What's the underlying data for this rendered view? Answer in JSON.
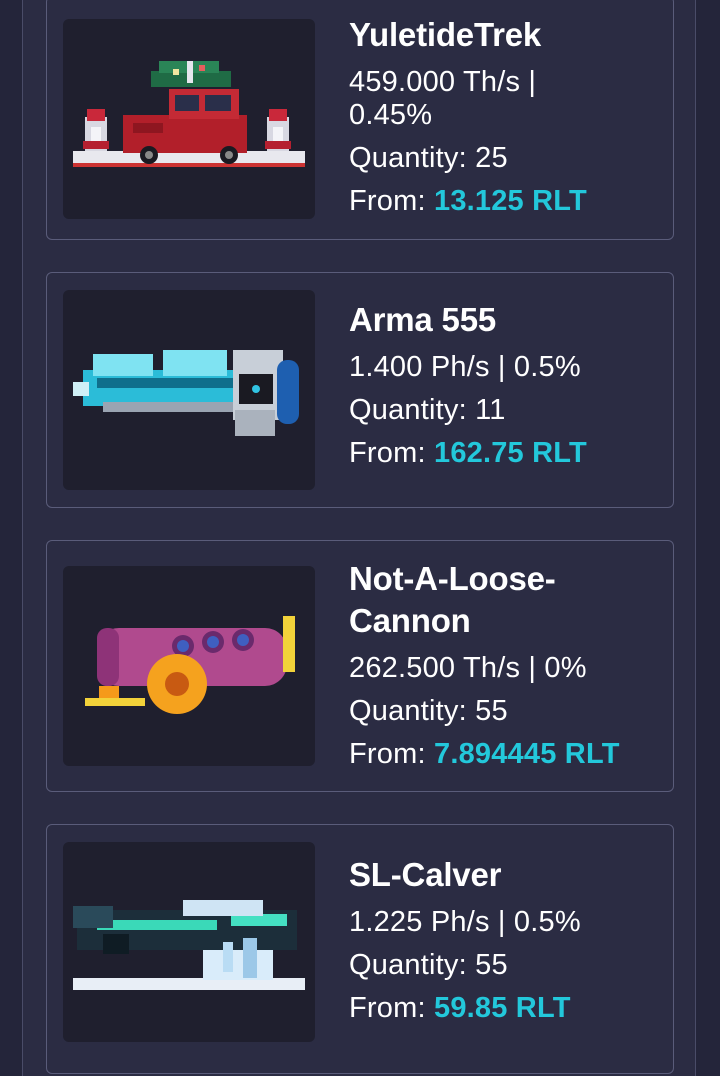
{
  "accent_color": "#23c8db",
  "items": [
    {
      "name": "YuletideTrek",
      "power_line_1": "459.000 Th/s |",
      "power_line_2": "0.45%",
      "quantity": "Quantity: 25",
      "from_label": "From:",
      "price": "13.125 RLT",
      "icon": "holiday-truck-miner-icon"
    },
    {
      "name": "Arma 555",
      "power": "1.400 Ph/s | 0.5%",
      "quantity": "Quantity: 11",
      "from_label": "From:",
      "price": "162.75 RLT",
      "icon": "ice-blaster-miner-icon"
    },
    {
      "name_line_1": "Not-A-Loose-",
      "name_line_2": "Cannon",
      "power": "262.500 Th/s | 0%",
      "quantity": "Quantity: 55",
      "from_label": "From:",
      "price": "7.894445 RLT",
      "icon": "cannon-miner-icon"
    },
    {
      "name": "SL-Calver",
      "power": "1.225 Ph/s | 0.5%",
      "quantity": "Quantity: 55",
      "from_label": "From:",
      "price": "59.85 RLT",
      "icon": "frost-cannon-miner-icon"
    }
  ]
}
